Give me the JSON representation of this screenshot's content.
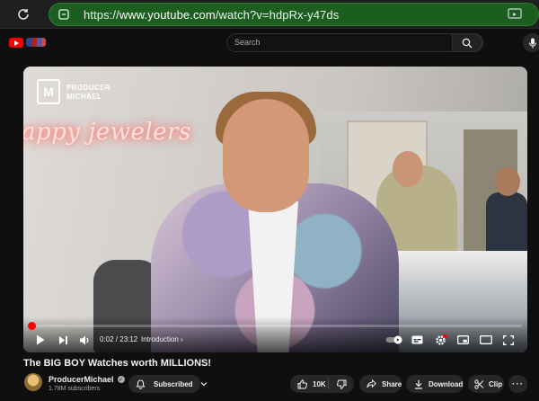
{
  "browser": {
    "url_prefix": "https://",
    "url_host": "www.youtube.com",
    "url_path": "/watch?v=hdpRx-y47ds",
    "icons": [
      "reload-icon",
      "lock-icon",
      "cast-icon"
    ]
  },
  "header": {
    "search_placeholder": "Search",
    "icons": [
      "youtube-logo-icon",
      "search-icon",
      "mic-icon"
    ]
  },
  "video": {
    "overlay_brand_line1": "PRODUCER",
    "overlay_brand_line2": "MICHAEL",
    "neon_sign": "appy jewelers",
    "current_time": "0:02",
    "duration": "23:12",
    "time_display": "0:02 / 23:12",
    "chapter": "Introduction",
    "progress_fraction": 0.0014,
    "accent_color": "#ff0000"
  },
  "details": {
    "title": "The BIG BOY Watches worth MILLIONS!",
    "channel_name": "ProducerMichael",
    "subscribers": "1.78M subscribers",
    "subscribed_label": "Subscribed",
    "like_count": "10K",
    "share_label": "Share",
    "download_label": "Download",
    "clip_label": "Clip"
  }
}
